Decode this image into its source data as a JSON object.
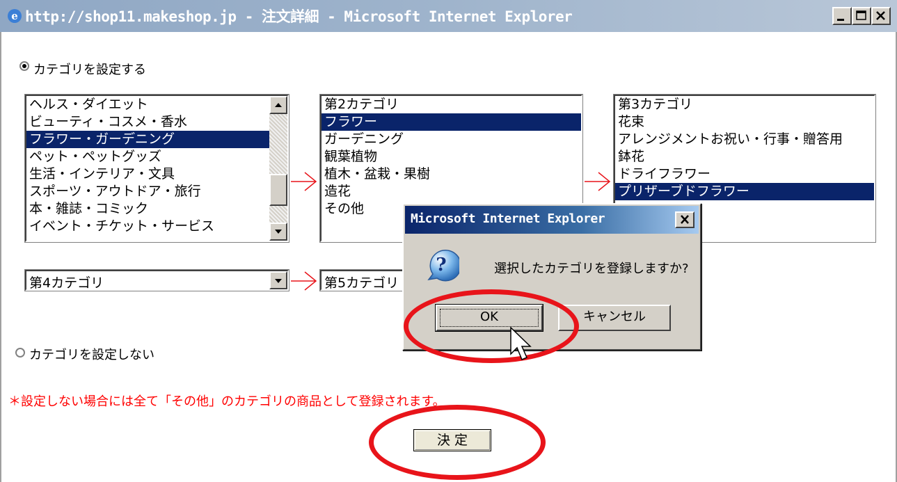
{
  "window": {
    "title": "http://shop11.makeshop.jp - 注文詳細 - Microsoft Internet Explorer"
  },
  "form": {
    "radio_set_label": "カテゴリを設定する",
    "radio_set_checked": true,
    "radio_unset_label": "カテゴリを設定しない",
    "radio_unset_checked": false,
    "list1": {
      "items": [
        "ヘルス・ダイエット",
        "ビューティ・コスメ・香水",
        "フラワー・ガーデニング",
        "ペット・ペットグッズ",
        "生活・インテリア・文具",
        "スポーツ・アウトドア・旅行",
        "本・雑誌・コミック",
        "イベント・チケット・サービス"
      ],
      "selected": "フラワー・ガーデニング"
    },
    "list2": {
      "items": [
        "第2カテゴリ",
        "フラワー",
        "ガーデニング",
        "観葉植物",
        "植木・盆栽・果樹",
        "造花",
        "その他"
      ],
      "selected": "フラワー"
    },
    "list3": {
      "items": [
        "第3カテゴリ",
        "花束",
        "アレンジメントお祝い・行事・贈答用",
        "鉢花",
        "ドライフラワー",
        "プリザーブドフラワー"
      ],
      "selected": "プリザーブドフラワー"
    },
    "select4": "第4カテゴリ",
    "select5": "第5カテゴリ",
    "note": "＊設定しない場合には全て「その他」のカテゴリの商品として登録されます。",
    "submit_label": "決 定"
  },
  "dialog": {
    "title": "Microsoft Internet Explorer",
    "message": "選択したカテゴリを登録しますか?",
    "ok_label": "OK",
    "cancel_label": "キャンセル",
    "icon": "question-icon"
  },
  "annotations": {
    "highlight_color": "#e8141a",
    "arrow_color": "#e8141a"
  }
}
